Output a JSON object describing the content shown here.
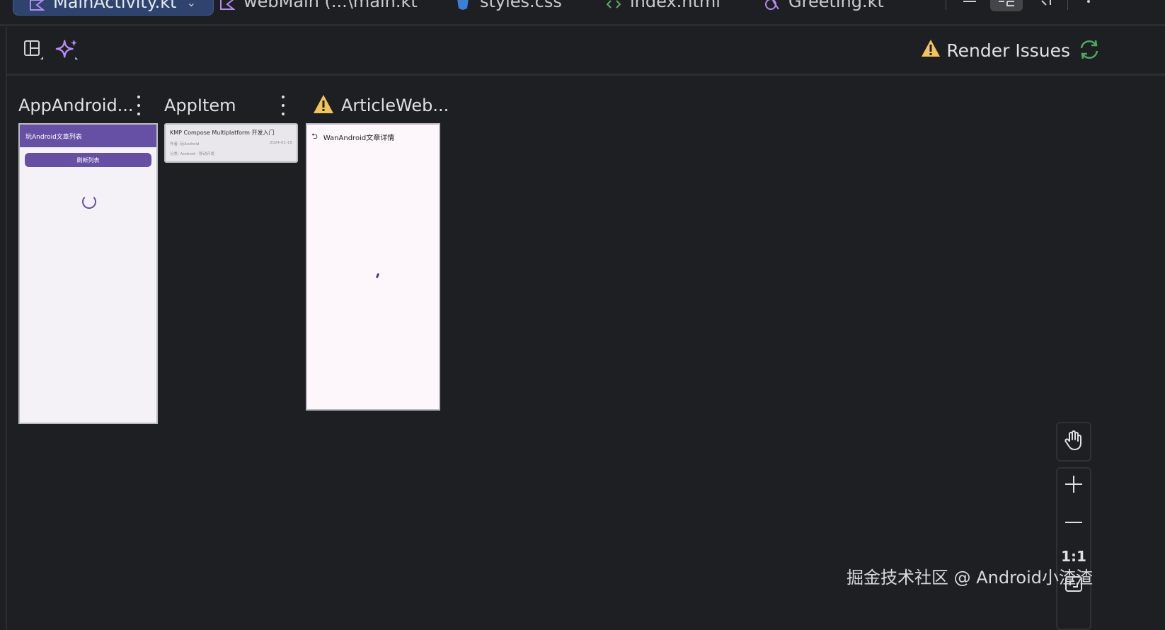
{
  "tabs": [
    {
      "label": "MainActivity.kt",
      "active": true
    },
    {
      "label": "webMain (...\\main.kt",
      "active": false
    },
    {
      "label": "styles.css",
      "active": false
    },
    {
      "label": "index.html",
      "active": false
    },
    {
      "label": "Greeting.kt",
      "active": false
    }
  ],
  "toolbar": {
    "layout_icon": "panel-layout-icon",
    "ai_icon": "sparkle-icon",
    "render_issues_label": "Render Issues",
    "refresh_icon": "refresh-icon"
  },
  "previews": [
    {
      "title": "AppAndroid..."
    },
    {
      "title": "AppItem"
    },
    {
      "title": "ArticleWeb..."
    }
  ],
  "app_preview": {
    "header": "玩Android文章列表",
    "refresh_button": "刷新列表"
  },
  "item_preview": {
    "title": "KMP Compose Multiplatform 开发入门",
    "author": "作者: 玩Android",
    "date": "2024-01-15",
    "category": "分类: Android · 移动开发"
  },
  "web_preview": {
    "title": "WanAndroid文章详情"
  },
  "zoom": {
    "one_to_one": "1:1"
  },
  "watermark": "掘金技术社区 @ Android小渣渣",
  "colors": {
    "accent": "#6650a4",
    "warning": "#f2c55c",
    "refresh": "#4da862",
    "background": "#1e1f22"
  }
}
